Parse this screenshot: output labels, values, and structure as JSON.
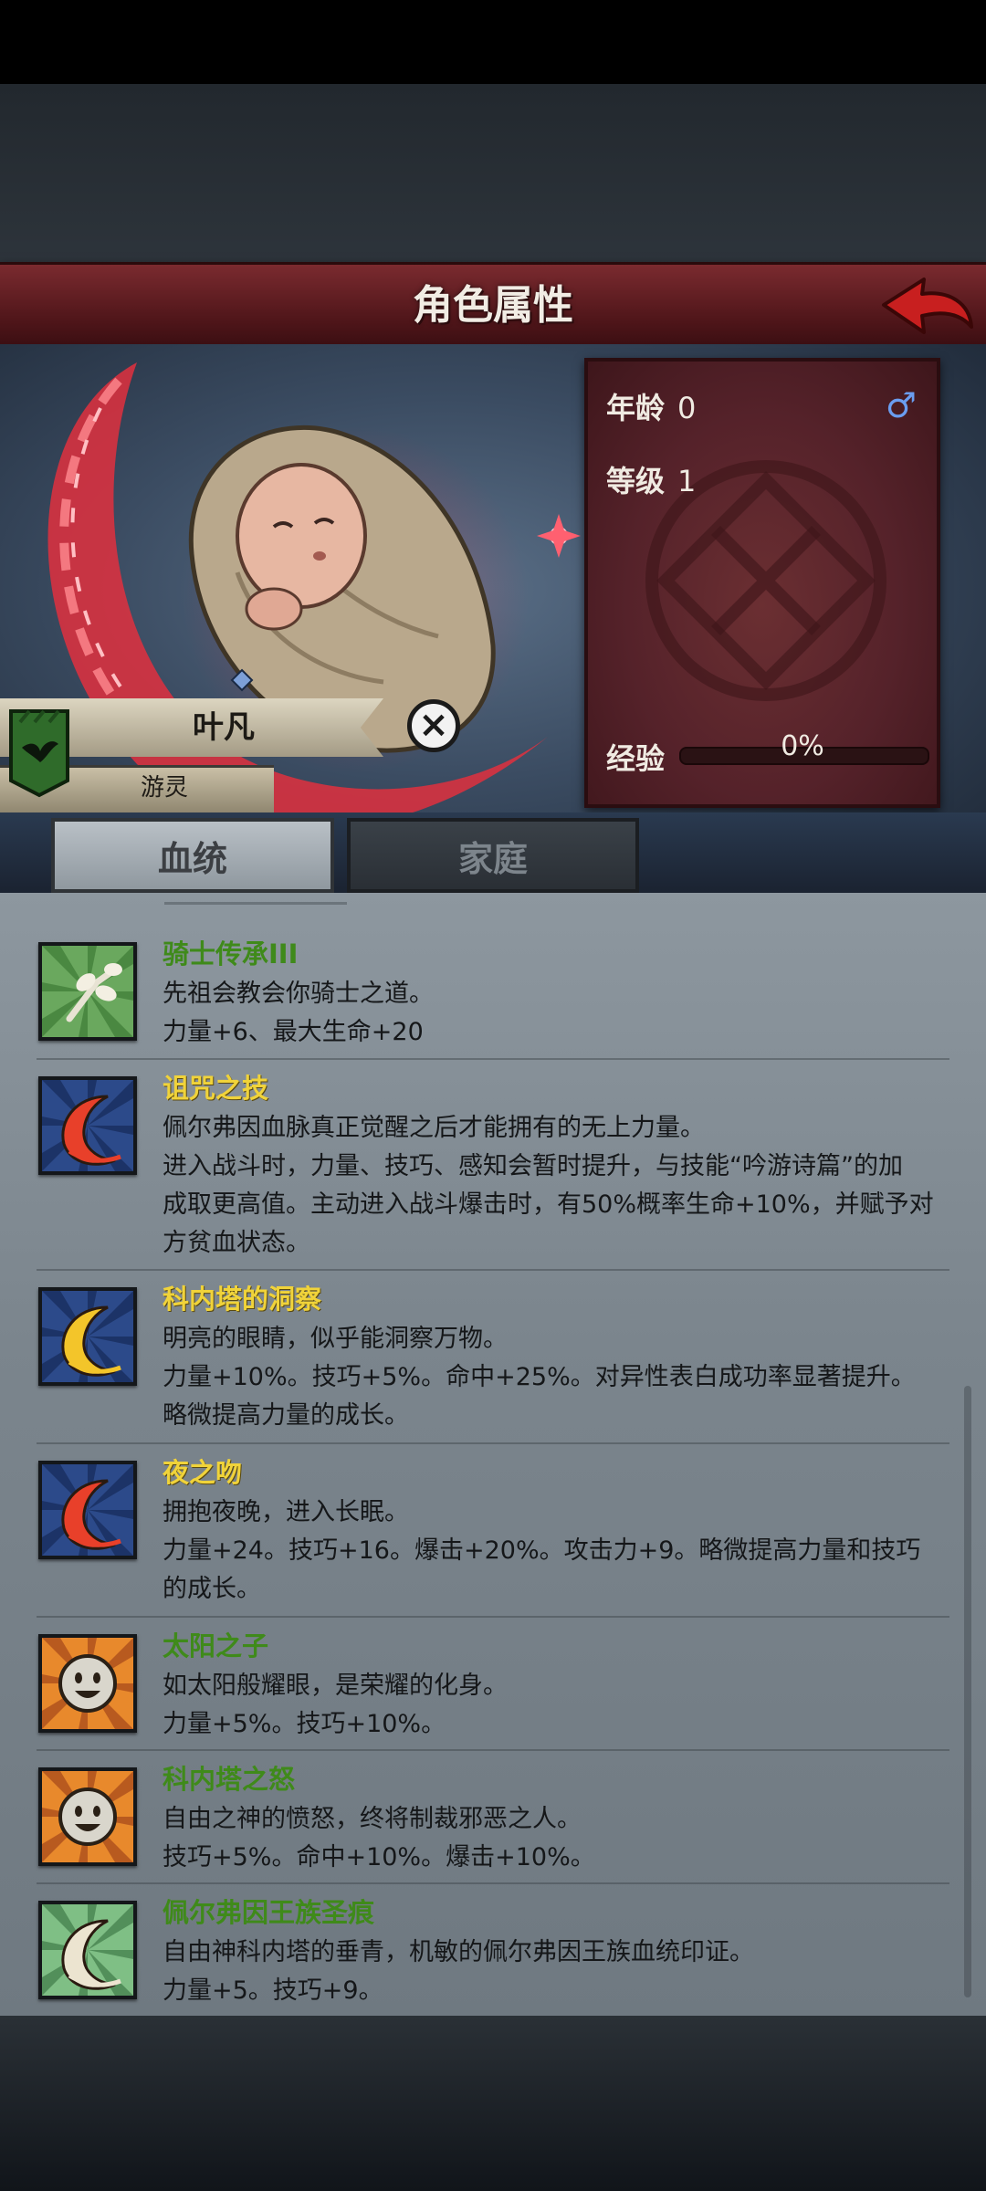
{
  "header": {
    "title": "角色属性"
  },
  "character": {
    "name": "叶凡",
    "subtitle": "游灵"
  },
  "stats": {
    "age_label": "年龄",
    "age_value": "0",
    "level_label": "等级",
    "level_value": "1",
    "exp_label": "经验",
    "exp_value": "0%",
    "exp_fraction": 0,
    "gender_symbol": "♂"
  },
  "tabs": [
    {
      "label": "血统",
      "active": true
    },
    {
      "label": "家庭",
      "active": false
    }
  ],
  "colors": {
    "title_green": "#3f8a1a",
    "title_yellow": "#f0d33a"
  },
  "traits": [
    {
      "title": "骑士传承III",
      "color": "green",
      "lines": [
        "先祖会教会你骑士之道。",
        "力量+6、最大生命+20"
      ],
      "icon": "branch-icon"
    },
    {
      "title": "诅咒之技",
      "color": "yellow",
      "lines": [
        "佩尔弗因血脉真正觉醒之后才能拥有的无上力量。",
        "进入战斗时，力量、技巧、感知会暂时提升，与技能“吟游诗篇”的加",
        "成取更高值。主动进入战斗爆击时，有50%概率生命+10%，并赋予对",
        "方贫血状态。"
      ],
      "icon": "red-crescent-icon"
    },
    {
      "title": "科内塔的洞察",
      "color": "yellow",
      "lines": [
        "明亮的眼睛，似乎能洞察万物。",
        "力量+10%。技巧+5%。命中+25%。对异性表白成功率显著提升。",
        "略微提高力量的成长。"
      ],
      "icon": "gold-crescent-icon"
    },
    {
      "title": "夜之吻",
      "color": "yellow",
      "lines": [
        "拥抱夜晚，进入长眠。",
        "力量+24。技巧+16。爆击+20%。攻击力+9。略微提高力量和技巧",
        "的成长。"
      ],
      "icon": "red-crescent-icon"
    },
    {
      "title": "太阳之子",
      "color": "green",
      "lines": [
        "如太阳般耀眼，是荣耀的化身。",
        "力量+5%。技巧+10%。"
      ],
      "icon": "sun-face-icon"
    },
    {
      "title": "科内塔之怒",
      "color": "green",
      "lines": [
        "自由之神的愤怒，终将制裁邪恶之人。",
        "技巧+5%。命中+10%。爆击+10%。"
      ],
      "icon": "sun-face-icon"
    },
    {
      "title": "佩尔弗因王族圣痕",
      "color": "green",
      "lines": [
        "自由神科内塔的垂青，机敏的佩尔弗因王族血统印证。",
        "力量+5。技巧+9。"
      ],
      "icon": "white-crescent-icon"
    }
  ]
}
